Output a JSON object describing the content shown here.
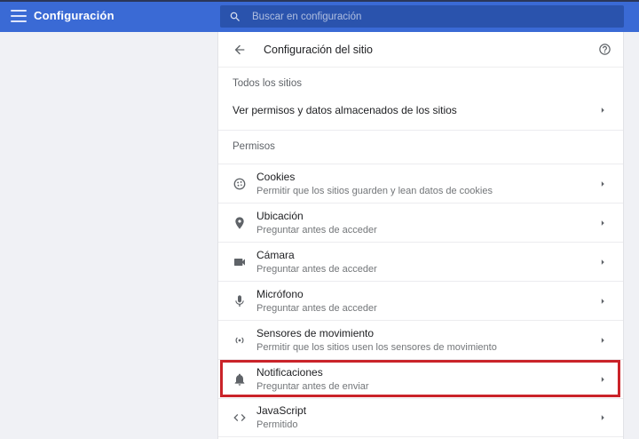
{
  "colors": {
    "header_background": "#3a6ad5",
    "search_background": "#2a53ad",
    "page_background": "#f0f1f5",
    "panel_background": "#ffffff",
    "highlight_border": "#ca2329",
    "primary_text": "#202124",
    "secondary_text": "#737679",
    "icon_gray": "#5f6368"
  },
  "icons": {
    "menu": "☰",
    "search": "🔍",
    "back": "←",
    "help": "?",
    "chevron_right": "▸"
  },
  "header": {
    "title": "Configuración",
    "search": {
      "placeholder": "Buscar en configuración",
      "value": ""
    }
  },
  "page": {
    "title": "Configuración del sitio"
  },
  "all_sites": {
    "section_label": "Todos los sitios",
    "view_permissions_label": "Ver permisos y datos almacenados de los sitios"
  },
  "permissions_section": {
    "label": "Permisos"
  },
  "permissions": [
    {
      "id": "cookies",
      "icon": "cookie-icon",
      "title": "Cookies",
      "subtitle": "Permitir que los sitios guarden y lean datos de cookies"
    },
    {
      "id": "location",
      "icon": "location-pin-icon",
      "title": "Ubicación",
      "subtitle": "Preguntar antes de acceder"
    },
    {
      "id": "camera",
      "icon": "video-camera-icon",
      "title": "Cámara",
      "subtitle": "Preguntar antes de acceder"
    },
    {
      "id": "microphone",
      "icon": "microphone-icon",
      "title": "Micrófono",
      "subtitle": "Preguntar antes de acceder"
    },
    {
      "id": "motion-sensors",
      "icon": "motion-sensors-icon",
      "title": "Sensores de movimiento",
      "subtitle": "Permitir que los sitios usen los sensores de movimiento"
    },
    {
      "id": "notifications",
      "icon": "bell-icon",
      "title": "Notificaciones",
      "subtitle": "Preguntar antes de enviar",
      "highlighted": true
    },
    {
      "id": "javascript",
      "icon": "code-icon",
      "title": "JavaScript",
      "subtitle": "Permitido"
    }
  ]
}
